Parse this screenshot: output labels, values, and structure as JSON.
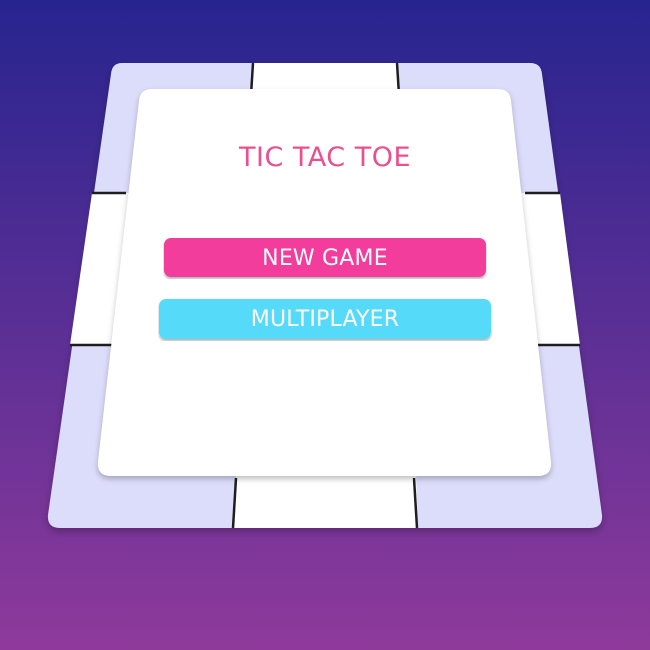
{
  "game": {
    "title": "TIC TAC TOE"
  },
  "menu": {
    "new_game_label": "NEW GAME",
    "multiplayer_label": "MULTIPLAYER"
  },
  "colors": {
    "background_top": "#27248f",
    "background_bottom": "#8e3a9b",
    "board_cell": "#dcdcfb",
    "board_cell_light": "#ffffff",
    "grid_line": "#1e1e1e",
    "panel": "#ffffff",
    "title": "#e8508f",
    "new_game": "#f23d9c",
    "multiplayer": "#56dafa",
    "button_text": "#ffffff"
  }
}
